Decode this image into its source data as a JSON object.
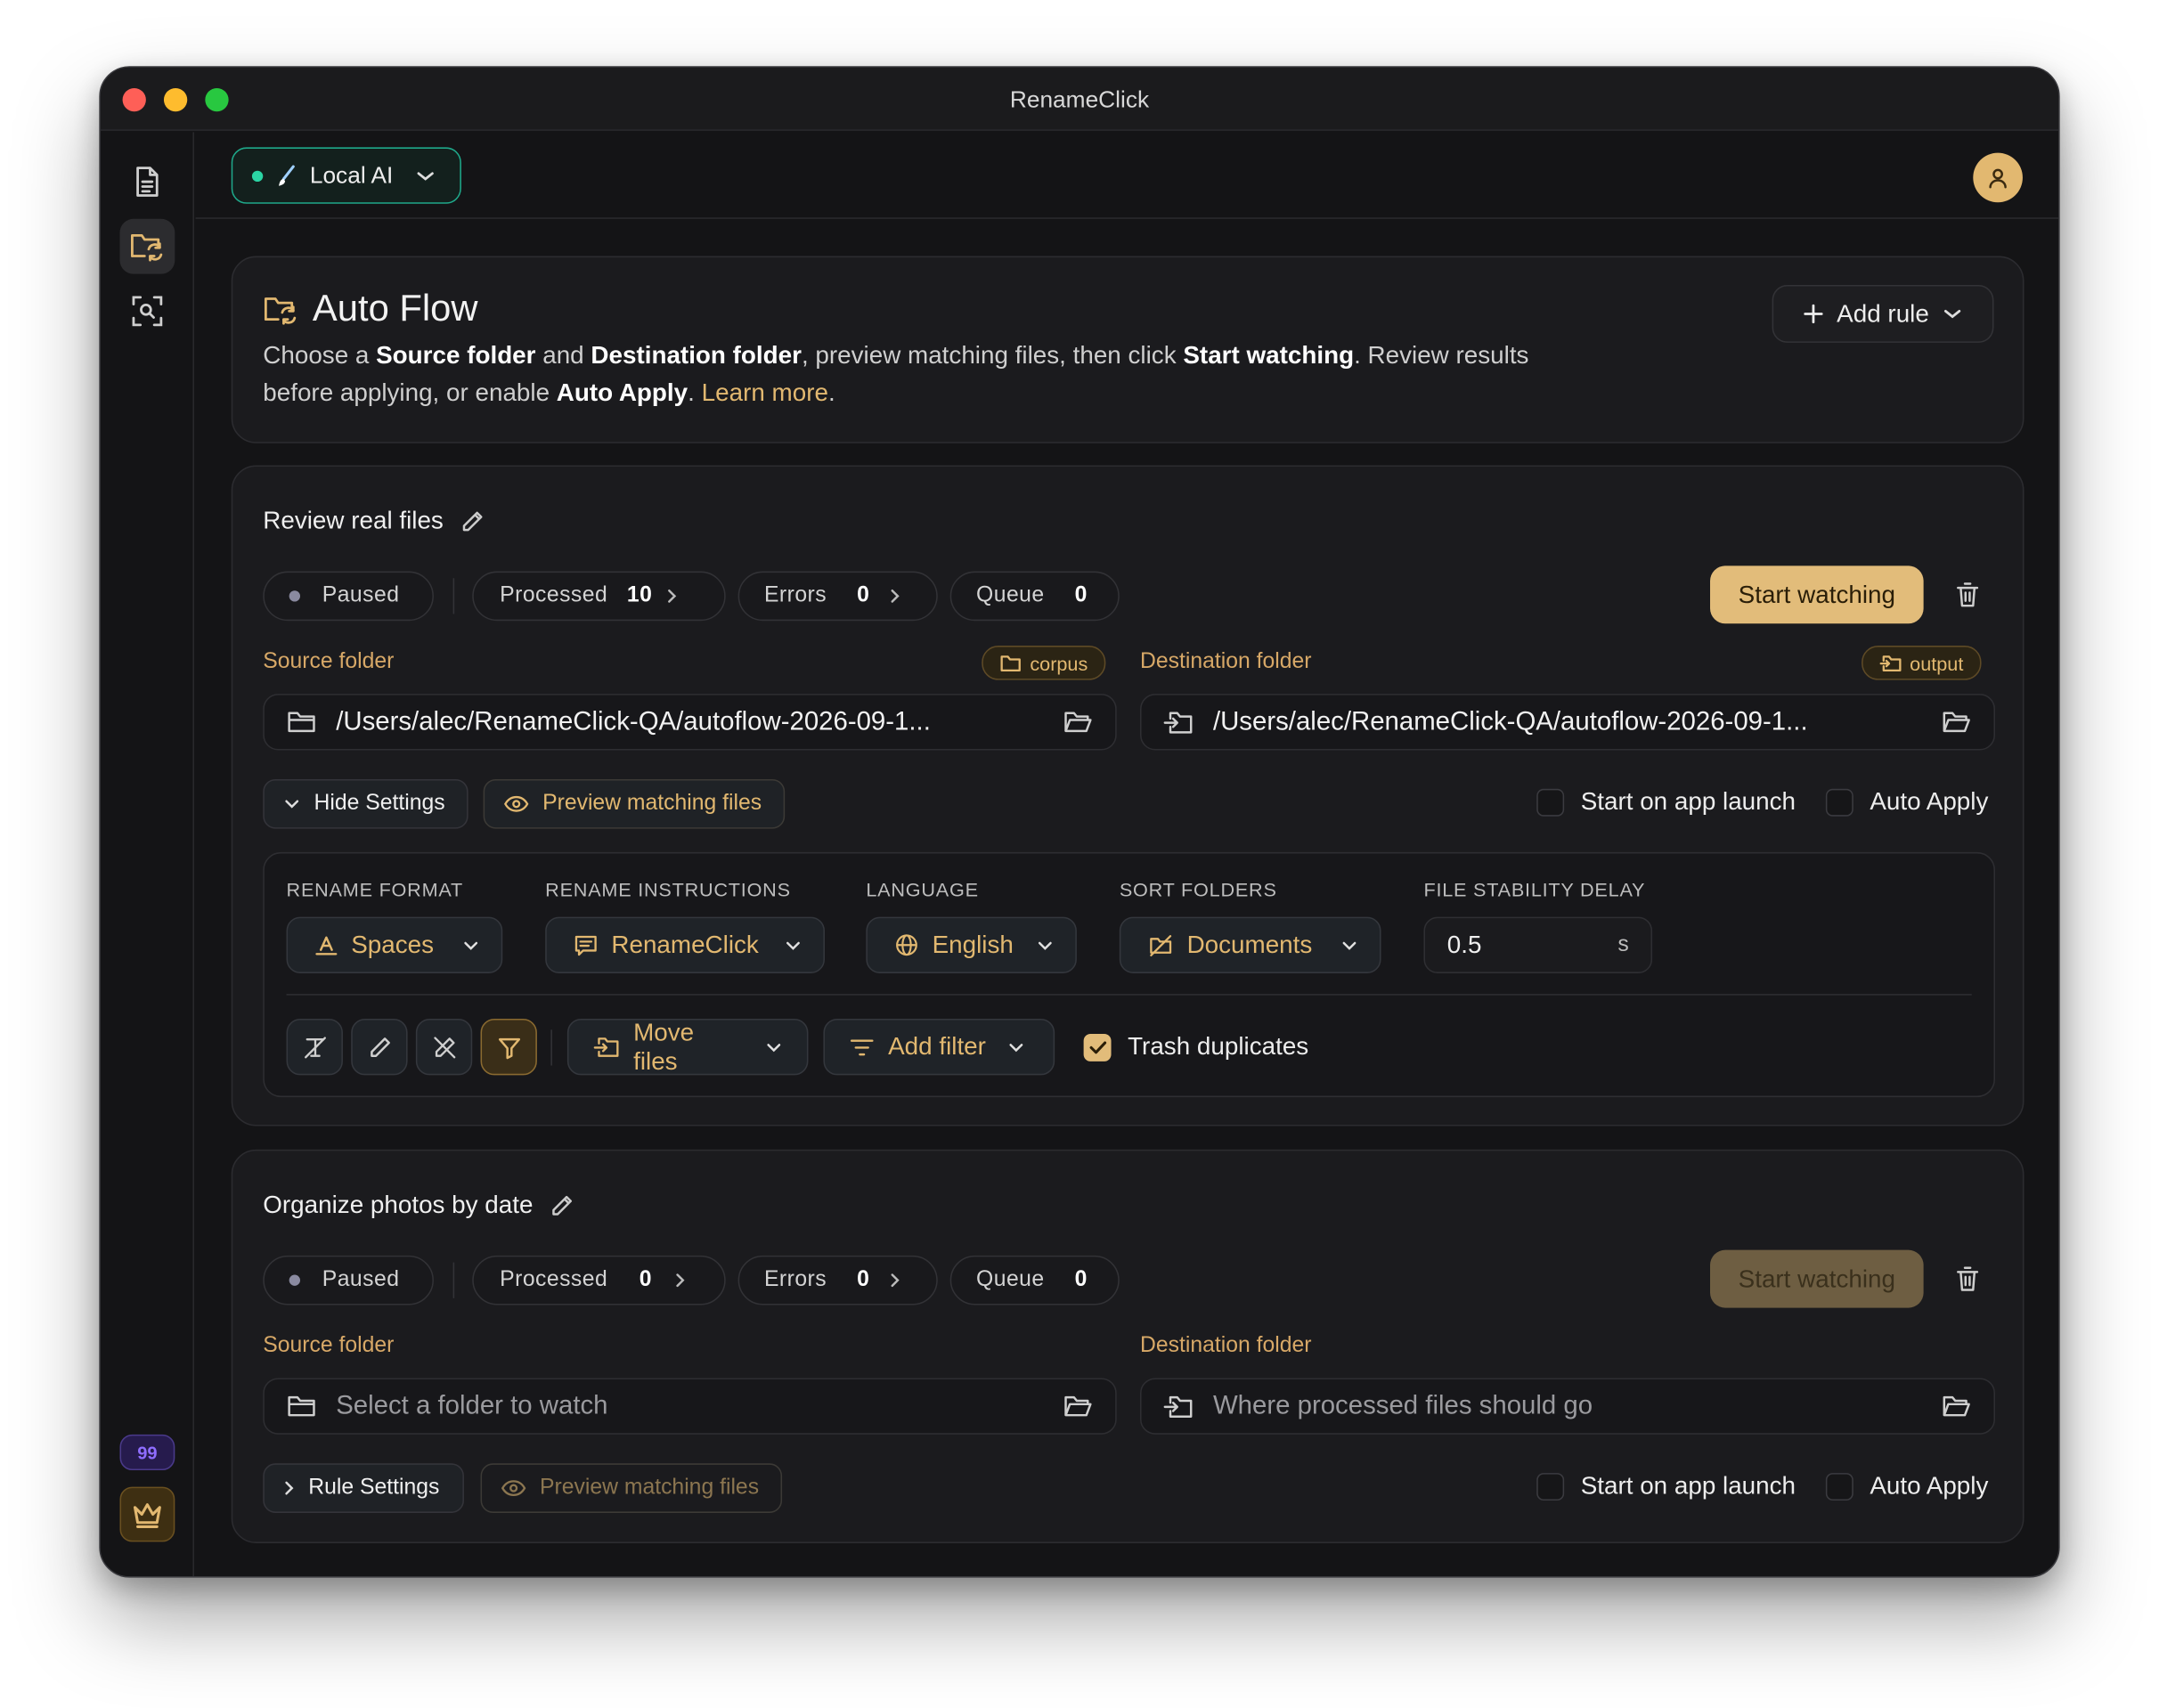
{
  "window": {
    "title": "RenameClick"
  },
  "topbar": {
    "model_label": "Local AI"
  },
  "sidebar": {
    "items": [
      {
        "icon": "document-icon"
      },
      {
        "icon": "folder-sync-icon",
        "active": true
      },
      {
        "icon": "scan-search-icon"
      }
    ],
    "badge": "99"
  },
  "intro": {
    "title": "Auto Flow",
    "desc": {
      "t1": "Choose a ",
      "b1": "Source folder",
      "t2": " and ",
      "b2": "Destination folder",
      "t3": ", preview matching files, then click ",
      "b3": "Start watching",
      "t4": ". Review results before applying, or enable ",
      "b4": "Auto Apply",
      "t5": ". ",
      "link": "Learn more",
      "t6": "."
    },
    "add_rule_label": "Add rule"
  },
  "rules": [
    {
      "name": "Review real files",
      "status": "Paused",
      "processed_label": "Processed",
      "processed": "10",
      "errors_label": "Errors",
      "errors": "0",
      "queue_label": "Queue",
      "queue": "0",
      "start_label": "Start watching",
      "source_label": "Source folder",
      "source_tag": "corpus",
      "source_path": "/Users/alec/RenameClick-QA/autoflow-2026-09-1...",
      "dest_label": "Destination folder",
      "dest_tag": "output",
      "dest_path": "/Users/alec/RenameClick-QA/autoflow-2026-09-1...",
      "settings_toggle": "Hide Settings",
      "preview_label": "Preview matching files",
      "start_on_launch": "Start on app launch",
      "auto_apply": "Auto Apply",
      "settings": {
        "format_label": "RENAME FORMAT",
        "format": "Spaces",
        "instructions_label": "RENAME INSTRUCTIONS",
        "instructions": "RenameClick",
        "language_label": "LANGUAGE",
        "language": "English",
        "sort_label": "SORT FOLDERS",
        "sort": "Documents",
        "delay_label": "FILE STABILITY DELAY",
        "delay": "0.5",
        "delay_unit": "s",
        "move_label": "Move files",
        "filter_label": "Add filter",
        "trash_label": "Trash duplicates",
        "trash_checked": true
      }
    },
    {
      "name": "Organize photos by date",
      "status": "Paused",
      "processed_label": "Processed",
      "processed": "0",
      "errors_label": "Errors",
      "errors": "0",
      "queue_label": "Queue",
      "queue": "0",
      "start_label": "Start watching",
      "source_label": "Source folder",
      "source_placeholder": "Select a folder to watch",
      "dest_label": "Destination folder",
      "dest_placeholder": "Where processed files should go",
      "settings_toggle": "Rule Settings",
      "preview_label": "Preview matching files",
      "start_on_launch": "Start on app launch",
      "auto_apply": "Auto Apply"
    }
  ],
  "colors": {
    "accent": "#e2bc7a",
    "online": "#2bd4a4",
    "background": "#141416",
    "card": "#1b1b1e"
  }
}
